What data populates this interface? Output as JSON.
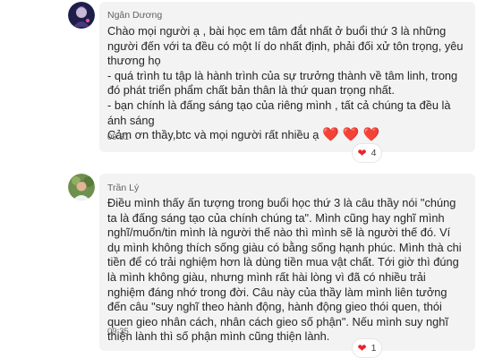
{
  "messages": [
    {
      "author": "Ngân Dương",
      "lines": [
        "Chào mọi người ạ , bài học em tâm đắt nhất ở buổi thứ 3 là những",
        "người đến với ta đều có một lí do nhất định, phải đối xử tôn trọng, yêu",
        "thương họ",
        "- quá trình tu tập là hành trình của sự trưởng thành về tâm linh, trong",
        "đó phát triển phẩm chất bản thân là thứ quan trọng nhất.",
        "- bạn chính là đấng sáng tạo của riêng mình , tất cả chúng ta đều là",
        "ánh sáng"
      ],
      "last_line": "Cảm ơn thầy,btc và mọi người rất nhiều ạ",
      "last_line_emoji": "❤️ ❤️ ❤️",
      "time": "09:31",
      "reaction": {
        "icon": "heart-icon",
        "count": "4"
      }
    },
    {
      "author": "Trần Lý",
      "lines": [
        "Điều mình thấy ấn tượng trong buổi học thứ 3 là câu thầy nói \"chúng",
        "ta là đấng sáng tạo của chính chúng ta\". Mình cũng hay nghĩ mình",
        "nghĩ/muốn/tin mình là người thế nào thì mình sẽ là người thế đó. Ví",
        "dụ mình không thích sống giàu có bằng sống hạnh phúc. Mình thà chi",
        "tiền để có trải nghiệm hơn là dùng tiền mua vật chất. Tới giờ thì đúng",
        "là mình không giàu, nhưng mình rất hài lòng vì đã có nhiều trải",
        "nghiệm đáng nhớ trong đời. Câu này của thầy làm mình liên tưởng",
        "đến câu \"suy nghĩ theo hành động, hành động gieo thói quen, thói",
        "quen gieo nhân cách, nhân cách gieo số phận\". Nếu mình suy nghĩ",
        "thiện lành thì số phận mình cũng thiện lành."
      ],
      "time": "09:35",
      "reaction": {
        "icon": "heart-icon",
        "count": "1"
      }
    }
  ],
  "colors": {
    "bubble_bg": "#f3f3f4",
    "heart": "#e8242e",
    "meta_text": "#616161"
  }
}
